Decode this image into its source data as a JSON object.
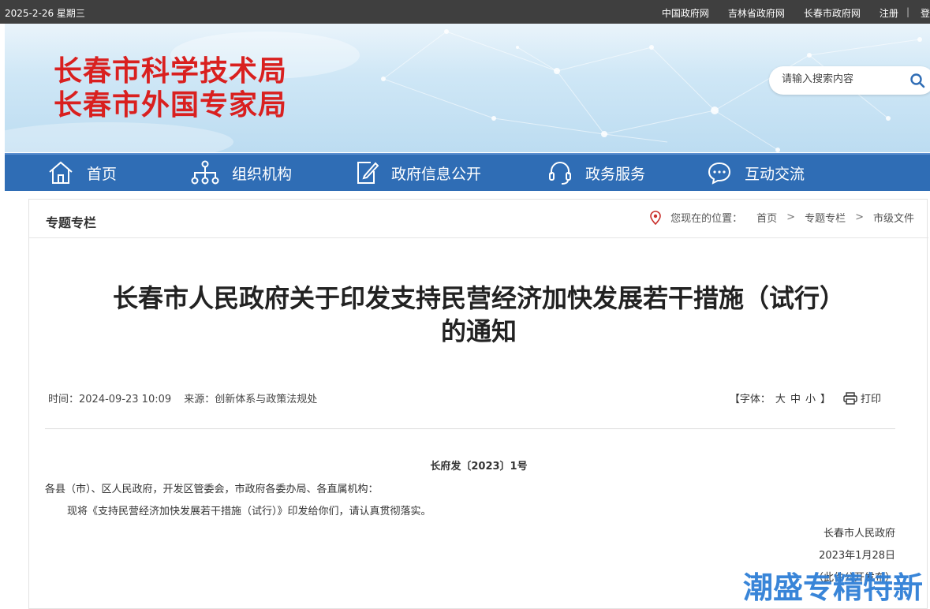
{
  "topbar": {
    "date": "2025-2-26 星期三",
    "links": [
      "中国政府网",
      "吉林省政府网",
      "长春市政府网",
      "注册"
    ],
    "separator": "|",
    "cut_link": "登"
  },
  "banner": {
    "title_line1": "长春市科学技术局",
    "title_line2": "长春市外国专家局",
    "search_placeholder": "请输入搜索内容"
  },
  "nav": {
    "items": [
      {
        "label": "首页",
        "icon": "home-icon"
      },
      {
        "label": "组织机构",
        "icon": "org-chart-icon"
      },
      {
        "label": "政府信息公开",
        "icon": "edit-document-icon"
      },
      {
        "label": "政务服务",
        "icon": "headset-icon"
      },
      {
        "label": "互动交流",
        "icon": "chat-bubble-icon"
      }
    ]
  },
  "section": {
    "label": "专题专栏",
    "location_label": "您现在的位置：",
    "breadcrumb": [
      "首页",
      "专题专栏",
      "市级文件"
    ],
    "breadcrumb_sep": ">"
  },
  "article": {
    "title_line1": "长春市人民政府关于印发支持民营经济加快发展若干措施（试行）",
    "title_line2": "的通知",
    "time": "时间：2024-09-23 10:09",
    "source": "来源：创新体系与政策法规处",
    "font_label": "【字体：",
    "font_sizes": [
      "大",
      "中",
      "小"
    ],
    "font_close": "】",
    "print_label": "打印",
    "doc_number": "长府发〔2023〕1号",
    "recipients": "各县（市）、区人民政府，开发区管委会，市政府各委办局、各直属机构：",
    "body": "现将《支持民营经济加快发展若干措施（试行）》印发给你们，请认真贯彻落实。",
    "signer": "长春市人民政府",
    "sign_date": "2023年1月28日",
    "note": "（此件公开发布）"
  },
  "watermark": "潮盛专精特新",
  "colors": {
    "topbar_bg": "#3f3f3f",
    "nav_bg": "#2f6db5",
    "banner_title": "#d9201f",
    "watermark": "#2f7fd6"
  }
}
